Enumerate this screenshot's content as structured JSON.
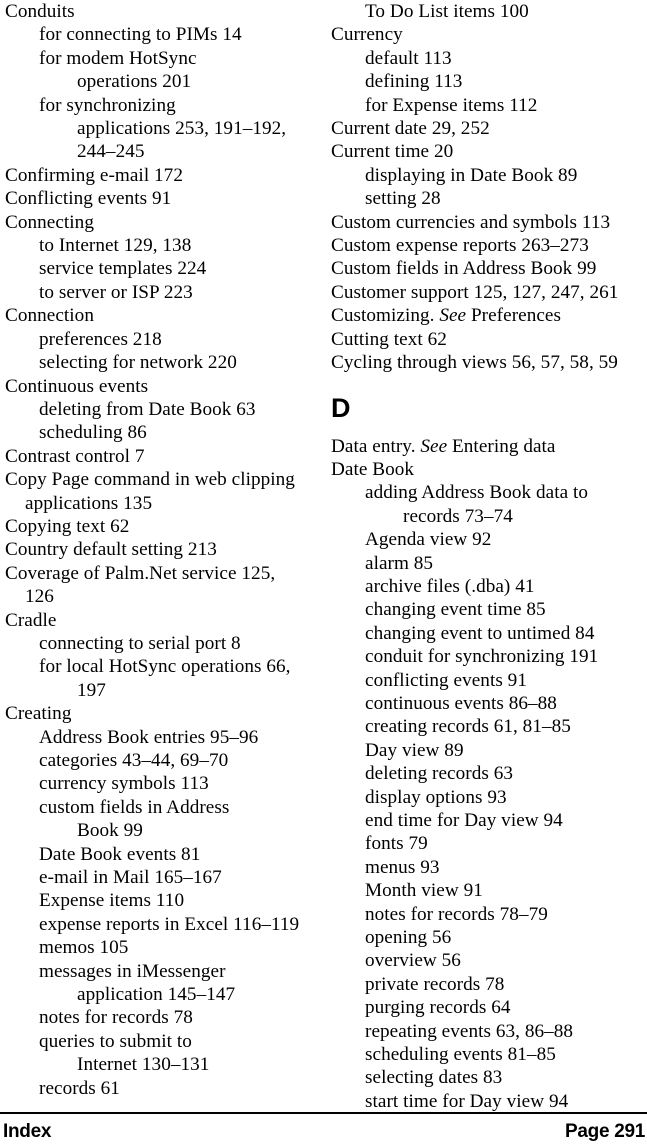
{
  "document": {
    "type": "book-index",
    "page_number_label": "Page 291",
    "running_head": "Index"
  },
  "footer": {
    "left_label": "Index",
    "right_label": "Page 291"
  },
  "columns": {
    "left": {
      "entries": [
        {
          "level": 0,
          "text": "Conduits"
        },
        {
          "level": 1,
          "text": "for connecting to PIMs 14"
        },
        {
          "level": 1,
          "text": "for modem HotSync"
        },
        {
          "level": 2,
          "text": "operations 201"
        },
        {
          "level": 1,
          "text": "for synchronizing"
        },
        {
          "level": 2,
          "text": "applications 253, 191–192,"
        },
        {
          "level": 2,
          "text": "244–245"
        },
        {
          "level": 0,
          "text": "Confirming e-mail 172"
        },
        {
          "level": 0,
          "text": "Conflicting events 91"
        },
        {
          "level": 0,
          "text": "Connecting"
        },
        {
          "level": 1,
          "text": "to Internet 129, 138"
        },
        {
          "level": 1,
          "text": "service templates 224"
        },
        {
          "level": 1,
          "text": "to server or ISP 223"
        },
        {
          "level": 0,
          "text": "Connection"
        },
        {
          "level": 1,
          "text": "preferences 218"
        },
        {
          "level": 1,
          "text": "selecting for network 220"
        },
        {
          "level": 0,
          "text": "Continuous events"
        },
        {
          "level": 1,
          "text": "deleting from Date Book 63"
        },
        {
          "level": 1,
          "text": "scheduling 86"
        },
        {
          "level": 0,
          "text": "Contrast control 7"
        },
        {
          "level": 0,
          "text": "Copy Page command in web clipping"
        },
        {
          "level": "0c",
          "text": "applications 135"
        },
        {
          "level": 0,
          "text": "Copying text 62"
        },
        {
          "level": 0,
          "text": "Country default setting 213"
        },
        {
          "level": 0,
          "text": "Coverage of Palm.Net service 125,"
        },
        {
          "level": "0c",
          "text": "126"
        },
        {
          "level": 0,
          "text": "Cradle"
        },
        {
          "level": 1,
          "text": "connecting to serial port 8"
        },
        {
          "level": 1,
          "text": "for local HotSync operations 66,"
        },
        {
          "level": 2,
          "text": "197"
        },
        {
          "level": 0,
          "text": "Creating"
        },
        {
          "level": 1,
          "text": "Address Book entries 95–96"
        },
        {
          "level": 1,
          "text": "categories 43–44, 69–70"
        },
        {
          "level": 1,
          "text": "currency symbols 113"
        },
        {
          "level": 1,
          "text": "custom fields in Address"
        },
        {
          "level": 2,
          "text": "Book 99"
        },
        {
          "level": 1,
          "text": "Date Book events 81"
        },
        {
          "level": 1,
          "text": "e-mail in Mail 165–167"
        },
        {
          "level": 1,
          "text": "Expense items 110"
        },
        {
          "level": 1,
          "text": "expense reports in Excel 116–119"
        },
        {
          "level": 1,
          "text": "memos 105"
        },
        {
          "level": 1,
          "text": "messages in iMessenger"
        },
        {
          "level": 2,
          "text": "application 145–147"
        },
        {
          "level": 1,
          "text": "notes for records 78"
        },
        {
          "level": 1,
          "text": "queries to submit to"
        },
        {
          "level": 2,
          "text": "Internet 130–131"
        },
        {
          "level": 1,
          "text": "records 61"
        }
      ]
    },
    "right": {
      "entries_before_heading": [
        {
          "level": 1,
          "text": "To Do List items 100"
        },
        {
          "level": 0,
          "text": "Currency"
        },
        {
          "level": 1,
          "text": "default 113"
        },
        {
          "level": 1,
          "text": "defining 113"
        },
        {
          "level": 1,
          "text": "for Expense items 112"
        },
        {
          "level": 0,
          "text": "Current date 29, 252"
        },
        {
          "level": 0,
          "text": "Current time 20"
        },
        {
          "level": 1,
          "text": "displaying in Date Book 89"
        },
        {
          "level": 1,
          "text": "setting 28"
        },
        {
          "level": 0,
          "text": "Custom currencies and symbols 113"
        },
        {
          "level": 0,
          "text": "Custom expense reports 263–273"
        },
        {
          "level": 0,
          "text": "Custom fields in Address Book 99"
        },
        {
          "level": 0,
          "text": "Customer support 125, 127, 247, 261"
        },
        {
          "level": 0,
          "text": "Customizing. ",
          "italic": "See",
          "text_after": " Preferences"
        },
        {
          "level": 0,
          "text": "Cutting text 62"
        },
        {
          "level": 0,
          "text": "Cycling through views 56, 57, 58, 59"
        }
      ],
      "section_heading": "D",
      "entries_after_heading": [
        {
          "level": 0,
          "text": "Data entry. ",
          "italic": "See",
          "text_after": " Entering data"
        },
        {
          "level": 0,
          "text": "Date Book"
        },
        {
          "level": 1,
          "text": "adding Address Book data to"
        },
        {
          "level": 2,
          "text": "records 73–74"
        },
        {
          "level": 1,
          "text": "Agenda view 92"
        },
        {
          "level": 1,
          "text": "alarm 85"
        },
        {
          "level": 1,
          "text": "archive files (.dba) 41"
        },
        {
          "level": 1,
          "text": "changing event time 85"
        },
        {
          "level": 1,
          "text": "changing event to untimed 84"
        },
        {
          "level": 1,
          "text": "conduit for synchronizing 191"
        },
        {
          "level": 1,
          "text": "conflicting events 91"
        },
        {
          "level": 1,
          "text": "continuous events 86–88"
        },
        {
          "level": 1,
          "text": "creating records 61, 81–85"
        },
        {
          "level": 1,
          "text": "Day view 89"
        },
        {
          "level": 1,
          "text": "deleting records 63"
        },
        {
          "level": 1,
          "text": "display options 93"
        },
        {
          "level": 1,
          "text": "end time for Day view 94"
        },
        {
          "level": 1,
          "text": "fonts 79"
        },
        {
          "level": 1,
          "text": "menus 93"
        },
        {
          "level": 1,
          "text": "Month view 91"
        },
        {
          "level": 1,
          "text": "notes for records 78–79"
        },
        {
          "level": 1,
          "text": "opening 56"
        },
        {
          "level": 1,
          "text": "overview 56"
        },
        {
          "level": 1,
          "text": "private records 78"
        },
        {
          "level": 1,
          "text": "purging records 64"
        },
        {
          "level": 1,
          "text": "repeating events 63, 86–88"
        },
        {
          "level": 1,
          "text": "scheduling events 81–85"
        },
        {
          "level": 1,
          "text": "selecting dates 83"
        },
        {
          "level": 1,
          "text": "start time for Day view 94"
        }
      ]
    }
  }
}
